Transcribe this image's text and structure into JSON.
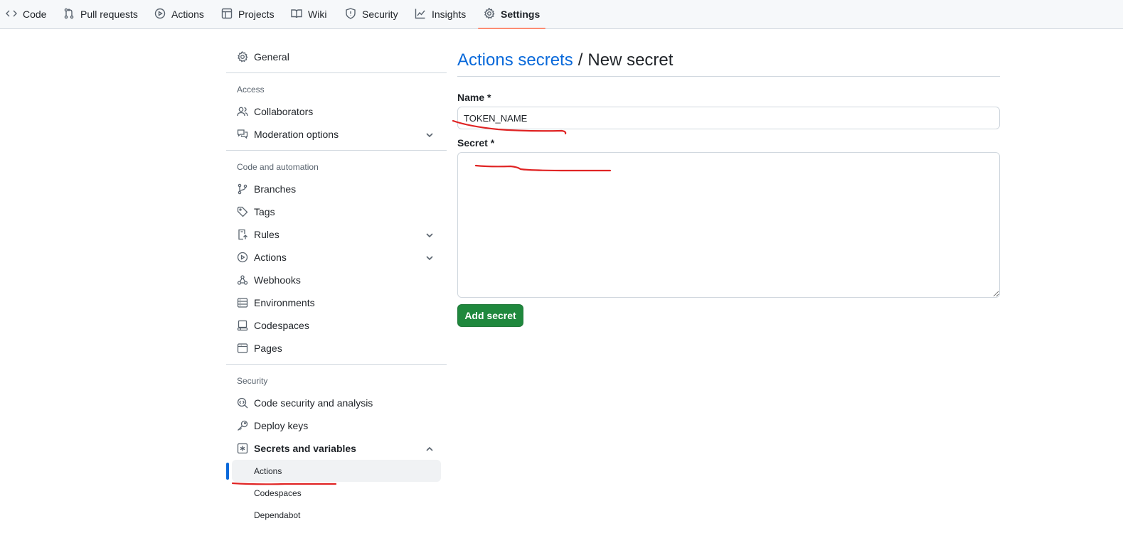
{
  "topnav": {
    "tabs": [
      {
        "label": "Code",
        "icon": "code-icon"
      },
      {
        "label": "Pull requests",
        "icon": "git-pull-request-icon"
      },
      {
        "label": "Actions",
        "icon": "play-icon"
      },
      {
        "label": "Projects",
        "icon": "table-icon"
      },
      {
        "label": "Wiki",
        "icon": "book-icon"
      },
      {
        "label": "Security",
        "icon": "shield-icon"
      },
      {
        "label": "Insights",
        "icon": "graph-icon"
      },
      {
        "label": "Settings",
        "icon": "gear-icon",
        "active": true
      }
    ],
    "active_underline_color": "#fd8c73"
  },
  "sidebar": {
    "general": "General",
    "access_heading": "Access",
    "collaborators": "Collaborators",
    "moderation": "Moderation options",
    "code_heading": "Code and automation",
    "branches": "Branches",
    "tags": "Tags",
    "rules": "Rules",
    "actions": "Actions",
    "webhooks": "Webhooks",
    "environments": "Environments",
    "codespaces": "Codespaces",
    "pages": "Pages",
    "security_heading": "Security",
    "code_security": "Code security and analysis",
    "deploy_keys": "Deploy keys",
    "secrets": "Secrets and variables",
    "secrets_sub": {
      "actions": "Actions",
      "codespaces": "Codespaces",
      "dependabot": "Dependabot"
    },
    "active_indicator_color": "#0969da"
  },
  "main": {
    "breadcrumb_link": "Actions secrets",
    "breadcrumb_sep": "/",
    "page_title": "New secret",
    "name_label": "Name *",
    "name_value": "TOKEN_NAME",
    "secret_label": "Secret *",
    "secret_value": "",
    "add_button": "Add secret",
    "button_color": "#1f883d"
  },
  "annotation_color": "#e02424"
}
